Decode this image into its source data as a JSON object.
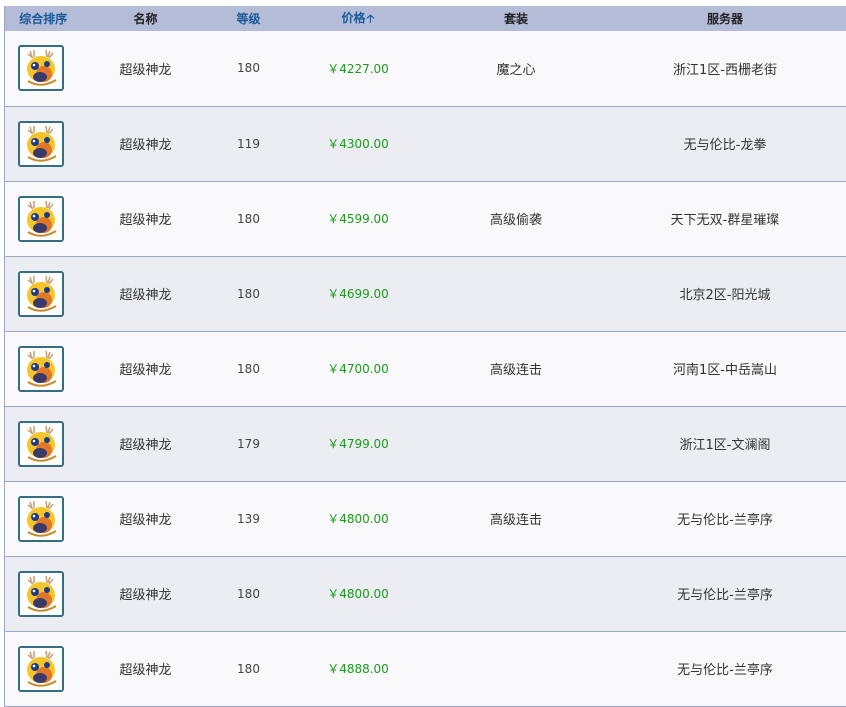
{
  "header": {
    "sort_default": "综合排序",
    "name": "名称",
    "level": "等级",
    "price": "价格",
    "price_sort_icon": "arrow-up",
    "suit": "套装",
    "server": "服务器"
  },
  "colors": {
    "header_bg": "#b4bcd8",
    "price": "#1a9c1a",
    "link": "#1a5a96",
    "row_odd": "#f9f9fb",
    "row_even": "#ebedf2"
  },
  "rows": [
    {
      "icon": "dragon-pet-icon",
      "name": "超级神龙",
      "level": "180",
      "price": "￥4227.00",
      "suit": "魔之心",
      "server": "浙江1区-西栅老街"
    },
    {
      "icon": "dragon-pet-icon",
      "name": "超级神龙",
      "level": "119",
      "price": "￥4300.00",
      "suit": "",
      "server": "无与伦比-龙拳"
    },
    {
      "icon": "dragon-pet-icon",
      "name": "超级神龙",
      "level": "180",
      "price": "￥4599.00",
      "suit": "高级偷袭",
      "server": "天下无双-群星璀璨"
    },
    {
      "icon": "dragon-pet-icon",
      "name": "超级神龙",
      "level": "180",
      "price": "￥4699.00",
      "suit": "",
      "server": "北京2区-阳光城"
    },
    {
      "icon": "dragon-pet-icon",
      "name": "超级神龙",
      "level": "180",
      "price": "￥4700.00",
      "suit": "高级连击",
      "server": "河南1区-中岳嵩山"
    },
    {
      "icon": "dragon-pet-icon",
      "name": "超级神龙",
      "level": "179",
      "price": "￥4799.00",
      "suit": "",
      "server": "浙江1区-文澜阁"
    },
    {
      "icon": "dragon-pet-icon",
      "name": "超级神龙",
      "level": "139",
      "price": "￥4800.00",
      "suit": "高级连击",
      "server": "无与伦比-兰亭序"
    },
    {
      "icon": "dragon-pet-icon",
      "name": "超级神龙",
      "level": "180",
      "price": "￥4800.00",
      "suit": "",
      "server": "无与伦比-兰亭序"
    },
    {
      "icon": "dragon-pet-icon",
      "name": "超级神龙",
      "level": "180",
      "price": "￥4888.00",
      "suit": "",
      "server": "无与伦比-兰亭序"
    }
  ]
}
